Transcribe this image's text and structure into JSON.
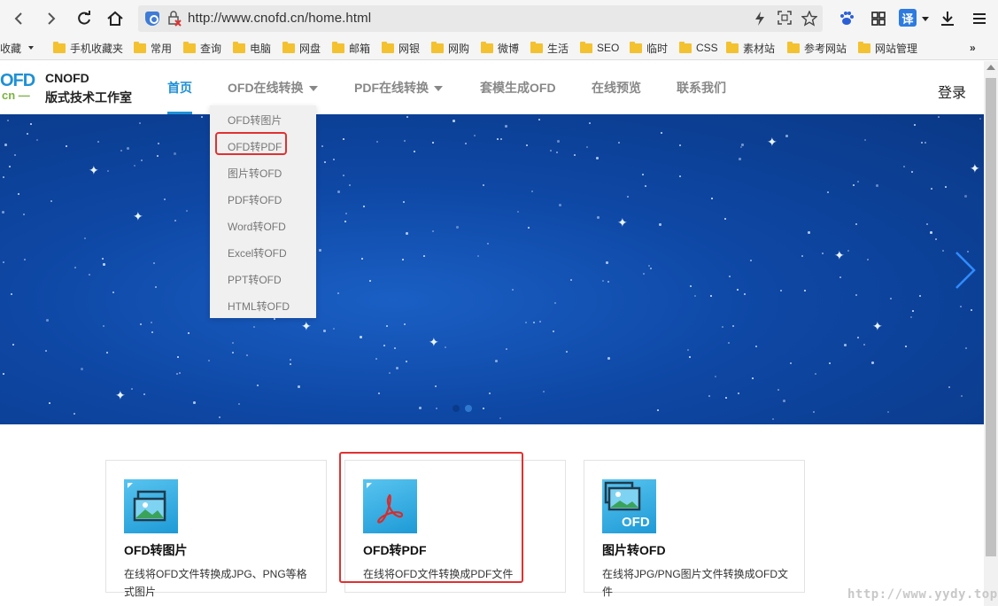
{
  "browser": {
    "url": "http://www.cnofd.cn/home.html",
    "translate_label": "译"
  },
  "bookmarks": [
    {
      "label": "收藏",
      "type": "menu"
    },
    {
      "label": "手机收藏夹",
      "type": "folder"
    },
    {
      "label": "常用",
      "type": "folder"
    },
    {
      "label": "查询",
      "type": "folder"
    },
    {
      "label": "电脑",
      "type": "folder"
    },
    {
      "label": "网盘",
      "type": "folder"
    },
    {
      "label": "邮箱",
      "type": "folder"
    },
    {
      "label": "网银",
      "type": "folder"
    },
    {
      "label": "网购",
      "type": "folder"
    },
    {
      "label": "微博",
      "type": "folder"
    },
    {
      "label": "生活",
      "type": "folder"
    },
    {
      "label": "SEO",
      "type": "folder"
    },
    {
      "label": "临时",
      "type": "folder"
    },
    {
      "label": "CSS",
      "type": "folder"
    },
    {
      "label": "素材站",
      "type": "folder"
    },
    {
      "label": "参考网站",
      "type": "folder"
    },
    {
      "label": "网站管理",
      "type": "folder"
    }
  ],
  "site": {
    "logo_ofd": "OFD",
    "logo_cn": "cn —",
    "name": "CNOFD",
    "subtitle": "版式技术工作室",
    "login": "登录"
  },
  "nav": [
    {
      "label": "首页",
      "active": true
    },
    {
      "label": "OFD在线转换",
      "dropdown": true
    },
    {
      "label": "PDF在线转换",
      "dropdown": true
    },
    {
      "label": "套模生成OFD"
    },
    {
      "label": "在线预览"
    },
    {
      "label": "联系我们"
    }
  ],
  "dropdown": [
    "OFD转图片",
    "OFD转PDF",
    "图片转OFD",
    "PDF转OFD",
    "Word转OFD",
    "Excel转OFD",
    "PPT转OFD",
    "HTML转OFD"
  ],
  "cards": [
    {
      "title": "OFD转图片",
      "desc": "在线将OFD文件转换成JPG、PNG等格式图片"
    },
    {
      "title": "OFD转PDF",
      "desc": "在线将OFD文件转换成PDF文件"
    },
    {
      "title": "图片转OFD",
      "desc": "在线将JPG/PNG图片文件转换成OFD文件",
      "badge": "OFD"
    }
  ],
  "watermark": "http://www.yydy.top",
  "colors": {
    "accent": "#1e90d6",
    "highlight": "#e03131",
    "banner": "#0e47a4"
  }
}
